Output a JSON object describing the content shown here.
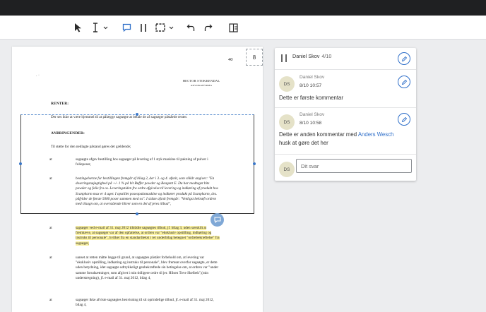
{
  "toolbar": {
    "tools": [
      {
        "name": "select-tool",
        "icon": "arrow-pointer-icon"
      },
      {
        "name": "text-select-tool",
        "icon": "text-cursor-icon"
      },
      {
        "name": "comment-tool",
        "icon": "comment-icon",
        "active": true
      },
      {
        "name": "pause-tool",
        "icon": "two-bars-icon"
      },
      {
        "name": "area-select-tool",
        "icon": "dashed-rectangle-icon"
      },
      {
        "name": "undo-button",
        "icon": "undo-icon"
      },
      {
        "name": "redo-button",
        "icon": "redo-icon"
      },
      {
        "name": "panel-toggle-button",
        "icon": "panel-icon"
      }
    ]
  },
  "document": {
    "page_number": "40",
    "page_badge": "8",
    "letterhead_line1": "HECTOR STOKKENDAL",
    "letterhead_line2": "ADVOKATFIRMA",
    "marks": ". ·",
    "heading_renter": "RENTER:",
    "renter_text": "Der ses ikke at være hjemmel til at pålægge sagsøgte at betale de af sagsøger påståede renter.",
    "heading_anbringender": "ANBRINGENDER:",
    "intro_text": "Til støtte for den nedlagte påstand gøres det gældende;",
    "items": [
      {
        "at": "at",
        "text": "sagsøgte afgav bestilling hos sagsøger på levering af 1 styk maskine til pakning af pulver i folieposer,"
      },
      {
        "at": "at",
        "text": "bestingelserne for bestillingen fremgår af bilag 2, der i 3. og 4. afsnit, som vilkår angiver: \"En doseringsnøjagtighed på +/- 1 % på bit Buffer powder og Reagent E. Du har modtaget bits powder og folie fra os. Leveringstiden fra ordre afgivelse til levering og indkøring af produkt hos Scanpharm max er 4 uger. I opstillet poseopaksmaskine og indkører produkt på Scanpharm, dvs. påfylder de første 5000 poser sammen med os\". I sidste afsnit fremgår: \"Venligst bekræft ordren med tilsagn om, at overstående bliver som en del af jeres tilbud\","
      },
      {
        "at": "at",
        "text": "sagsøger ved e-mail af 31. maj 2012 tiltrådte sagsøgtes tilbud, jf. bilag 3, uden særskilt at fremhæve, at sagsøger var af den opfattelse, at ordren var \"eksklusiv opstilling, indkøring og instruks til personale\", hvilket fra en standardtekst i ret underbilag betegnet \"ordrebekræftelse\" fra sagsøger,",
        "highlight": true
      },
      {
        "at": "at",
        "text": "uanset at retten måtte lægge til grund, at sagsøgtes påstået forbehold om, at levering var \"eksklusiv opstilling, indkøring og instruks til personale\", blev fremsat overfor sagsøgte, er dette uden betydning, idet sagsøgte udtrykkeligt genbekræftede sin betingelse om, at ordren var \"under samme forudsætninger, som afgivet i min tidligere ordre til jer. Hilsen Tove Skelbek\",(min understregning), jf. e-mail af 31. maj 2012, bilag 4,"
      },
      {
        "at": "at",
        "text": "sagsøger ikke afviste sagsøgtes henvisning til sit oprindelige tilbud, jf. e-mail af 31. maj 2012, bilag 4,"
      }
    ]
  },
  "comments_panel": {
    "header_author": "Daniel Skov",
    "header_count": "4/10",
    "comments": [
      {
        "initials": "DS",
        "author": "Daniel Skov",
        "time": "8/10 10:57",
        "text": "Dette er første kommentar"
      },
      {
        "initials": "DS",
        "author": "Daniel Skov",
        "time": "8/10 10:58",
        "text_before": "Dette er anden kommentar med ",
        "mention": "Anders Wesch",
        "text_after": "husk at gøre det her"
      }
    ],
    "reply_initials": "DS",
    "reply_placeholder": "Dit svar"
  },
  "colors": {
    "accent": "#2f6fc9",
    "highlight": "#fbf2a2",
    "topbar": "#1f2022"
  }
}
